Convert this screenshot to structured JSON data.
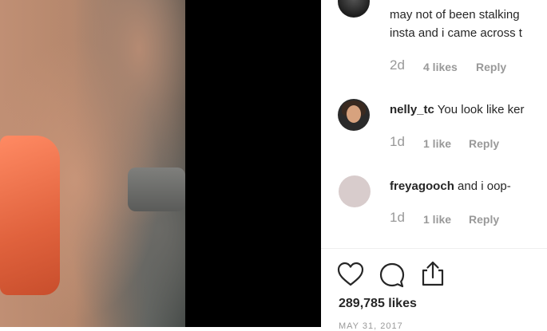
{
  "comments": [
    {
      "line1": "may not of been stalking",
      "line2": "insta and i came across t",
      "time": "2d",
      "likes": "4 likes",
      "reply": "Reply"
    },
    {
      "user": "nelly_tc",
      "text": "You look like ker",
      "time": "1d",
      "likes": "1 like",
      "reply": "Reply"
    },
    {
      "user": "freyagooch",
      "text": "and i oop-",
      "time": "1d",
      "likes": "1 like",
      "reply": "Reply"
    }
  ],
  "actions": {
    "like_icon": "heart-icon",
    "comment_icon": "speech-bubble-icon",
    "share_icon": "share-icon"
  },
  "post": {
    "likes_count": "289,785 likes",
    "date": "MAY 31, 2017"
  },
  "colors": {
    "text": "#262626",
    "muted": "#999999",
    "divider": "#efefef"
  }
}
